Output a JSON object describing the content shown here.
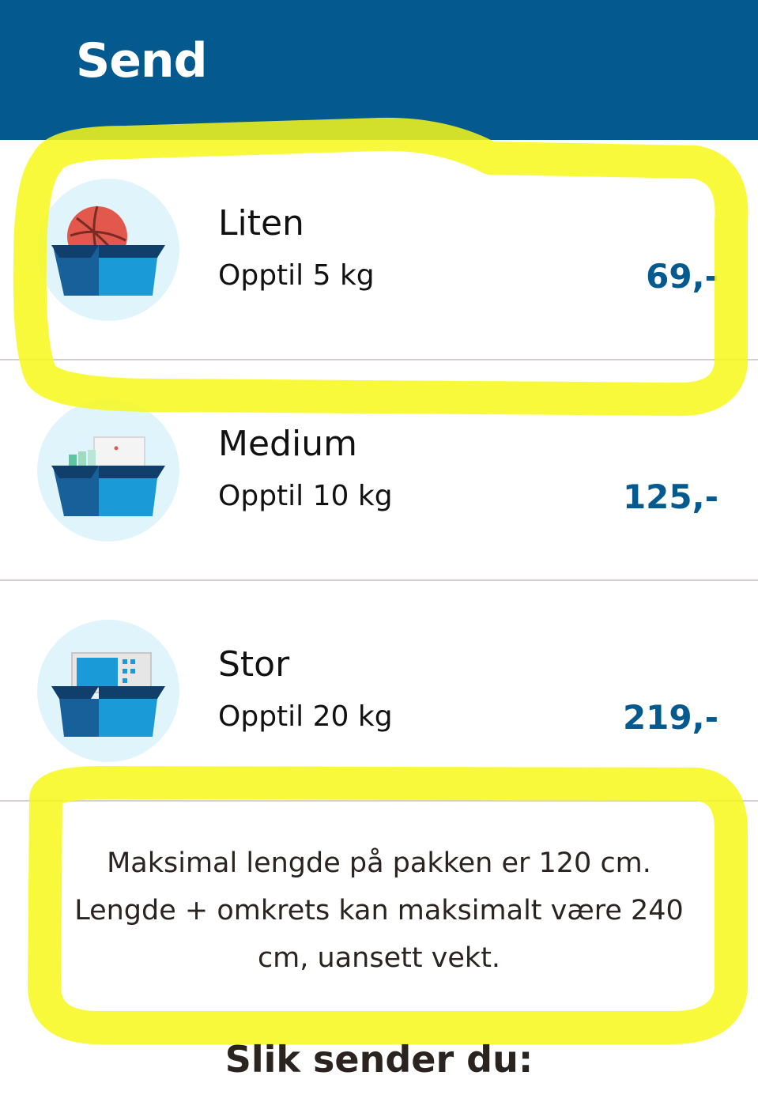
{
  "header": {
    "title": "Send",
    "background_color": "#045a8f"
  },
  "packages": [
    {
      "name": "Liten",
      "weight": "Opptil 5 kg",
      "price": "69,-",
      "icon": "box-with-ball-icon"
    },
    {
      "name": "Medium",
      "weight": "Opptil 10 kg",
      "price": "125,-",
      "icon": "box-with-books-icon"
    },
    {
      "name": "Stor",
      "weight": "Opptil 20 kg",
      "price": "219,-",
      "icon": "box-with-microwave-icon"
    }
  ],
  "info": {
    "line1": "Maksimal lengde på pakken er 120 cm.",
    "line2": "Lengde + omkrets kan maksimalt være 240",
    "line3": "cm, uansett vekt."
  },
  "how_to": {
    "title": "Slik sender du:"
  },
  "colors": {
    "accent": "#045a8f",
    "highlight": "#f8f81a",
    "icon_bg": "#dff4fb"
  }
}
